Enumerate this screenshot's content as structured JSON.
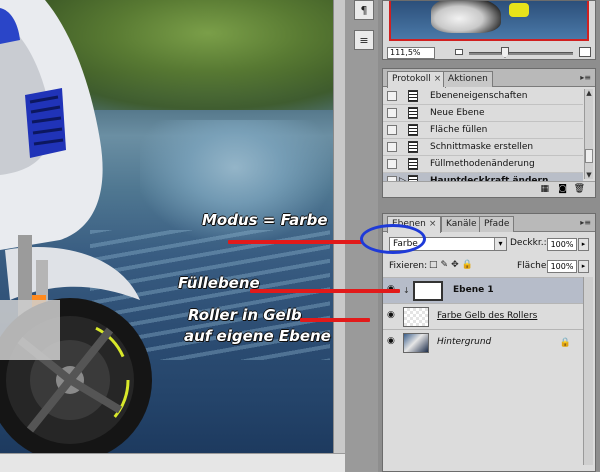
{
  "navigator": {
    "zoom": "111,5%"
  },
  "history": {
    "tabs": [
      {
        "label": "Protokoll",
        "active": true
      },
      {
        "label": "Aktionen",
        "active": false
      }
    ],
    "items": [
      {
        "label": "Ebeneneigenschaften",
        "selected": false
      },
      {
        "label": "Neue Ebene",
        "selected": false
      },
      {
        "label": "Fläche füllen",
        "selected": false
      },
      {
        "label": "Schnittmaske erstellen",
        "selected": false
      },
      {
        "label": "Füllmethodenänderung",
        "selected": false
      },
      {
        "label": "Hauptdeckkraft ändern",
        "selected": true
      }
    ]
  },
  "layers_panel": {
    "tabs": [
      {
        "label": "Ebenen",
        "active": true
      },
      {
        "label": "Kanäle",
        "active": false
      },
      {
        "label": "Pfade",
        "active": false
      }
    ],
    "blend_mode": "Farbe",
    "opacity_label": "Deckkr.:",
    "opacity_value": "100%",
    "lock_label": "Fixieren:",
    "fill_label": "Fläche:",
    "fill_value": "100%",
    "layers": [
      {
        "name": "Ebene 1",
        "selected": true
      },
      {
        "name": "Farbe Gelb des Rollers",
        "selected": false
      },
      {
        "name": "Hintergrund",
        "selected": false
      }
    ]
  },
  "annotations": {
    "mode": "Modus = Farbe",
    "fill_layer": "Füllebene",
    "roller_line1": "Roller in Gelb",
    "roller_line2": "auf eigene Ebene"
  },
  "colors": {
    "annotation_line": "#e21a1a",
    "annotation_circle": "#1e3ad8",
    "selection": "#b6bcc9"
  }
}
